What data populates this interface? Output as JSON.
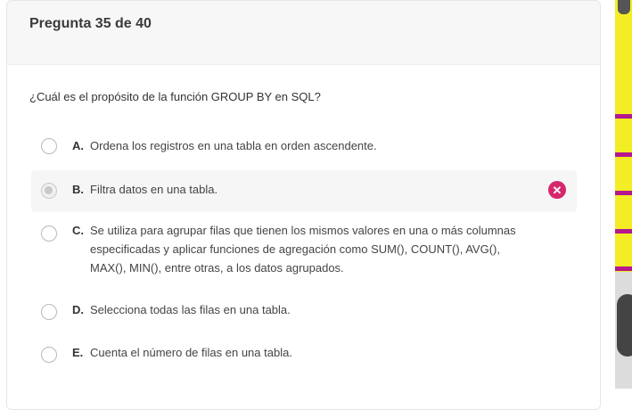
{
  "header": {
    "title": "Pregunta 35 de 40"
  },
  "question": {
    "text": "¿Cuál es el propósito de la función GROUP BY en SQL?"
  },
  "options": [
    {
      "letter": "A.",
      "text": "Ordena los registros en una tabla en orden ascendente.",
      "selected": false,
      "wrong": false
    },
    {
      "letter": "B.",
      "text": "Filtra datos en una tabla.",
      "selected": true,
      "wrong": true
    },
    {
      "letter": "C.",
      "text": "Se utiliza para agrupar filas que tienen los mismos valores en una o más columnas especificadas y aplicar funciones de agregación como SUM(), COUNT(), AVG(), MAX(), MIN(), entre otras, a los datos agrupados.",
      "selected": false,
      "wrong": false
    },
    {
      "letter": "D.",
      "text": "Selecciona todas las filas en una tabla.",
      "selected": false,
      "wrong": false
    },
    {
      "letter": "E.",
      "text": "Cuenta el número de filas en una tabla.",
      "selected": false,
      "wrong": false
    }
  ],
  "icons": {
    "wrong": "close-circle-icon"
  },
  "colors": {
    "wrong": "#d6276d",
    "strip_yellow": "#f2ed25",
    "strip_magenta": "#b5178d"
  }
}
